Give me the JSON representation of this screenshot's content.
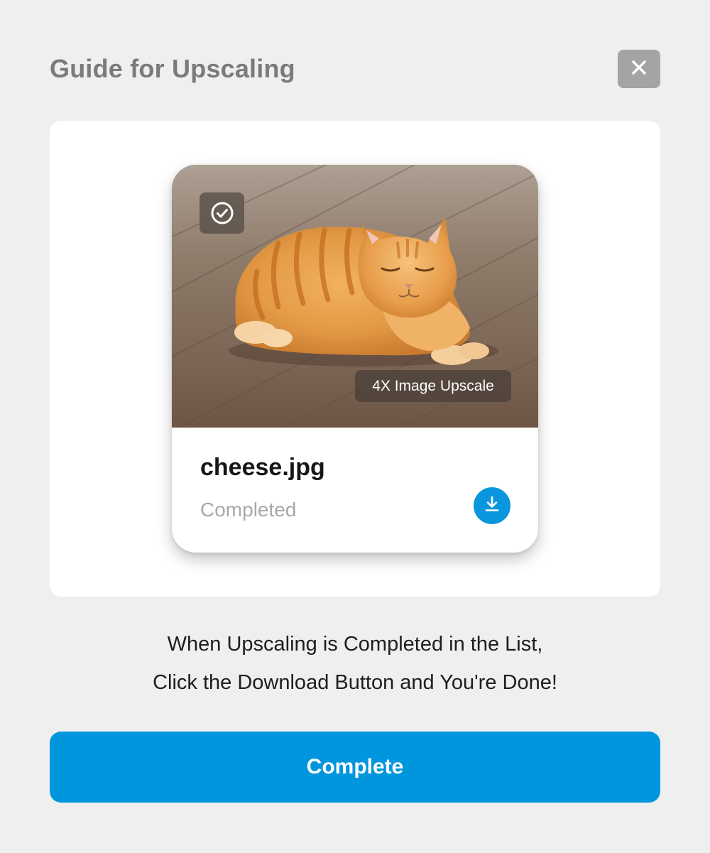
{
  "dialog": {
    "title": "Guide for Upscaling",
    "close_icon": "close-icon"
  },
  "card": {
    "image_alt": "orange tabby cat lying on wooden floor",
    "check_icon": "check-circle-icon",
    "tag": "4X Image Upscale",
    "filename": "cheese.jpg",
    "status": "Completed",
    "download_icon": "download-icon"
  },
  "instructions": {
    "line1": "When Upscaling is Completed in the List,",
    "line2": "Click the Download Button and You're Done!"
  },
  "complete_button": {
    "label": "Complete"
  },
  "colors": {
    "accent": "#0096dd",
    "background": "#efefef",
    "title": "#7b7b7b"
  }
}
